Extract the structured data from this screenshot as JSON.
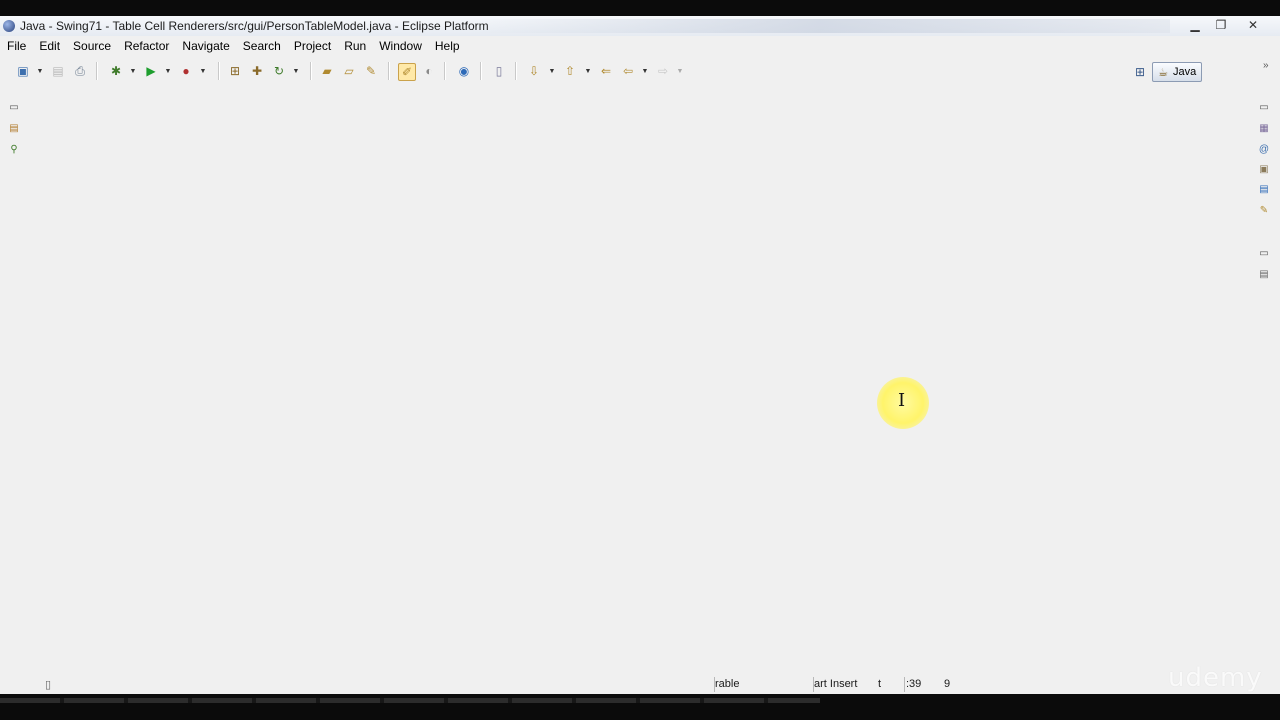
{
  "window": {
    "title": "Java - Swing71 - Table Cell Renderers/src/gui/PersonTableModel.java - Eclipse Platform",
    "controls": {
      "minimize": "▁",
      "maximize": "❐",
      "close": "✕"
    }
  },
  "menubar": {
    "items": [
      "File",
      "Edit",
      "Source",
      "Refactor",
      "Navigate",
      "Search",
      "Project",
      "Run",
      "Window",
      "Help"
    ]
  },
  "toolbar": {
    "icons": {
      "new": "new-wizard-icon",
      "save": "save-icon",
      "print": "print-icon",
      "debug": "debug-icon",
      "run": "run-icon",
      "external_tools": "external-tools-icon",
      "new_package": "new-java-package-icon",
      "new_class": "new-java-class-icon",
      "refresh": "refresh-icon",
      "open_type": "open-type-icon",
      "open_task": "open-task-icon",
      "search": "search-icon",
      "toggle_mark": "toggle-mark-occurrences-icon",
      "show_whitespace": "show-whitespace-icon",
      "globe": "web-browser-icon",
      "block_selection": "block-selection-icon",
      "next_annotation": "next-annotation-icon",
      "prev_annotation": "previous-annotation-icon",
      "last_edit": "last-edit-location-icon",
      "back": "back-icon",
      "forward": "forward-icon"
    },
    "glyphs": {
      "new": "▣",
      "save": "▤",
      "print": "⎙",
      "debug": "✱",
      "run": "▶",
      "external": "●",
      "new_package": "⊞",
      "new_class": "✚",
      "refresh": "↻",
      "open_type": "▰",
      "open_task": "▱",
      "search": "✎",
      "toggle_mark": "✐",
      "show_whitespace": "◐",
      "globe": "◉",
      "block": "▯",
      "next_ann": "⇩",
      "prev_ann": "⇧",
      "last_edit": "⇐",
      "back": "⇦",
      "forward": "⇨",
      "dropdown": "▼"
    },
    "colors": {
      "run": "#1e9e2e",
      "debug": "#3f7b2a",
      "external": "#b03030",
      "globe": "#2d6ab8"
    }
  },
  "perspective": {
    "open_perspective_icon": "open-perspective-icon",
    "open_perspective_glyph": "⊞",
    "java_label": "Java",
    "java_icon": "java-perspective-icon",
    "java_glyph": "☕",
    "chevron": "»"
  },
  "left_trim": {
    "glyphs": [
      "▭",
      "▤",
      "⚲"
    ],
    "icons": [
      "restore-icon",
      "package-explorer-icon",
      "hierarchy-icon"
    ]
  },
  "right_trim": {
    "glyphs": [
      "▭",
      "▦",
      "@",
      "▣",
      "▤",
      "✎",
      "▭",
      "▤"
    ],
    "icons": [
      "restore-icon",
      "outline-icon",
      "javadoc-icon",
      "declaration-icon",
      "problems-icon",
      "tasks-icon",
      "restore-icon",
      "console-icon"
    ]
  },
  "statusbar": {
    "left_icon": "fast-view-icon",
    "left_glyph": "▯",
    "writable": "rable",
    "insert_mode": "art Insert",
    "position_a": "t",
    "position_b": ":39",
    "position_c": "9"
  },
  "watermark": {
    "text": "udemy"
  },
  "cursor": {
    "glyph": "I"
  }
}
